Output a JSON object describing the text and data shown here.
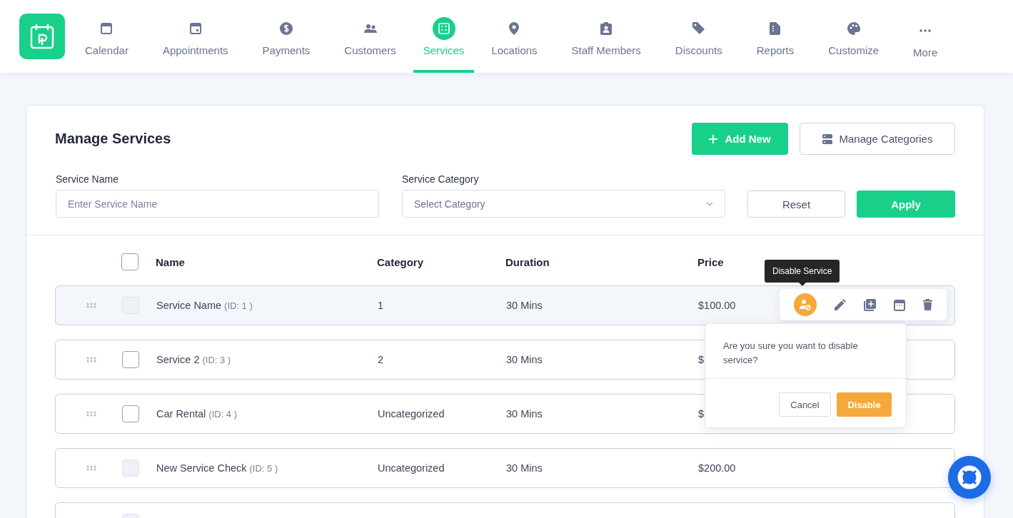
{
  "nav": {
    "items": [
      {
        "label": "Calendar",
        "selected": false
      },
      {
        "label": "Appointments",
        "selected": false
      },
      {
        "label": "Payments",
        "selected": false
      },
      {
        "label": "Customers",
        "selected": false
      },
      {
        "label": "Services",
        "selected": true
      },
      {
        "label": "Locations",
        "selected": false
      },
      {
        "label": "Staff Members",
        "selected": false
      },
      {
        "label": "Discounts",
        "selected": false
      },
      {
        "label": "Reports",
        "selected": false
      },
      {
        "label": "Customize",
        "selected": false
      },
      {
        "label": "More",
        "selected": false
      }
    ]
  },
  "page": {
    "title": "Manage Services",
    "add_button": "Add New",
    "categories_button": "Manage Categories"
  },
  "filters": {
    "name_label": "Service Name",
    "name_placeholder": "Enter Service Name",
    "category_label": "Service Category",
    "category_placeholder": "Select Category",
    "reset": "Reset",
    "apply": "Apply"
  },
  "table": {
    "select_all": {
      "checked": false
    },
    "columns": [
      "Name",
      "Category",
      "Duration",
      "Price"
    ],
    "rows": [
      {
        "name": "Service Name",
        "id_label": "(ID: 1 )",
        "category": "1",
        "duration": "30 Mins",
        "price": "$100.00",
        "hovered": true,
        "disabled": true
      },
      {
        "name": "Service 2",
        "id_label": "(ID: 3 )",
        "category": "2",
        "duration": "30 Mins",
        "price": "$",
        "hovered": false,
        "disabled": false
      },
      {
        "name": "Car Rental",
        "id_label": "(ID: 4 )",
        "category": "Uncategorized",
        "duration": "30 Mins",
        "price": "$",
        "hovered": false,
        "disabled": false
      },
      {
        "name": "New Service Check",
        "id_label": "(ID: 5 )",
        "category": "Uncategorized",
        "duration": "30 Mins",
        "price": "$200.00",
        "hovered": false,
        "disabled": true
      }
    ]
  },
  "partial_rows": [
    {
      "disabled": true
    }
  ],
  "row_actions": {
    "tooltip": "Disable Service"
  },
  "confirm": {
    "message": "Are you sure you want to disable service?",
    "cancel": "Cancel",
    "confirm": "Disable"
  }
}
